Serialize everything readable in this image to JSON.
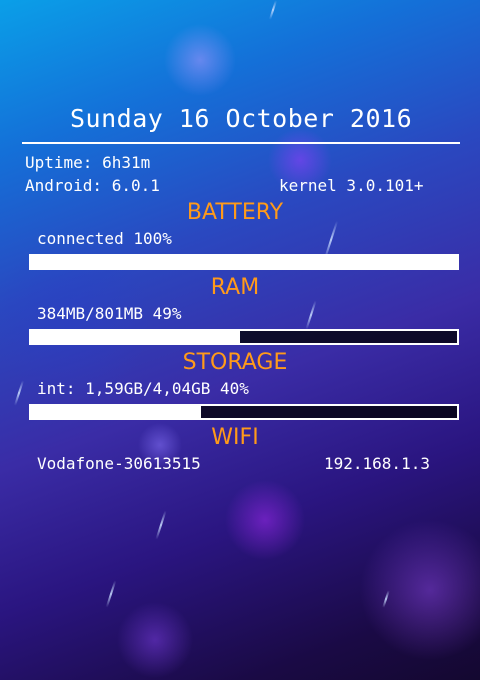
{
  "date": "Sunday 16 October 2016",
  "system": {
    "uptime": "Uptime: 6h31m",
    "android": "Android: 6.0.1",
    "kernel": "kernel 3.0.101+"
  },
  "battery": {
    "title": "BATTERY",
    "status": "connected 100%",
    "level": 1.0
  },
  "ram": {
    "title": "RAM",
    "status": "384MB/801MB 49%",
    "level": 0.49
  },
  "storage": {
    "title": "STORAGE",
    "status": "int: 1,59GB/4,04GB 40%",
    "level": 0.4
  },
  "wifi": {
    "title": "WIFI",
    "ssid": "Vodafone-30613515",
    "ip": "192.168.1.3"
  },
  "colors": {
    "section_title": "#ff9a1a",
    "text": "#ffffff",
    "bar_fill": "#ffffff"
  }
}
